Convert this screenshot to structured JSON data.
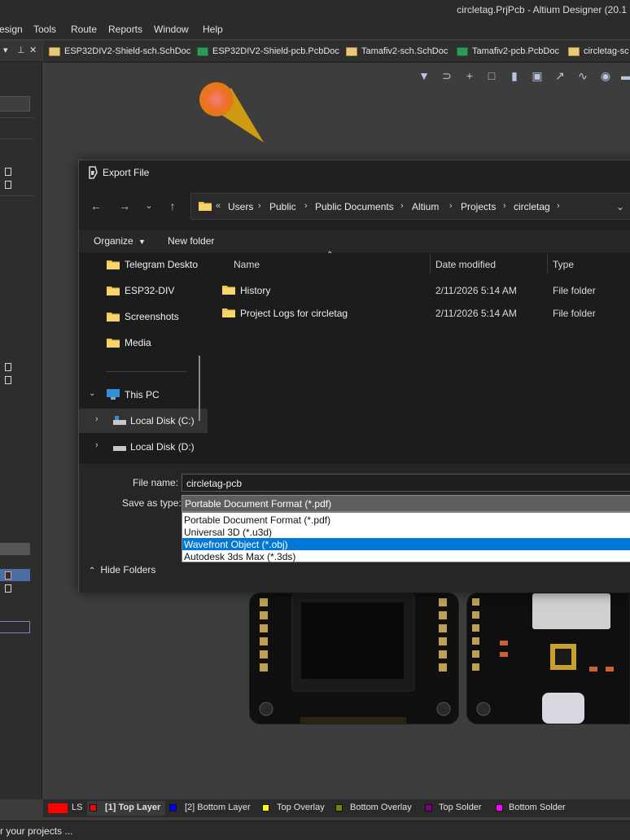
{
  "app": {
    "title": "circletag.PrjPcb - Altium Designer (20.1"
  },
  "menu": [
    "esign",
    "Tools",
    "Route",
    "Reports",
    "Window",
    "Help"
  ],
  "panel_header": {
    "pin": "▾",
    "lock": "⊥",
    "close": "✕"
  },
  "doc_tabs": [
    {
      "label": "ESP32DIV2-Shield-sch.SchDoc",
      "kind": "sch"
    },
    {
      "label": "ESP32DIV2-Shield-pcb.PcbDoc",
      "kind": "pcb"
    },
    {
      "label": "Tamafiv2-sch.SchDoc",
      "kind": "sch"
    },
    {
      "label": "Tamafiv2-pcb.PcbDoc",
      "kind": "pcb"
    },
    {
      "label": "circletag-sc",
      "kind": "sch"
    }
  ],
  "dialog": {
    "title": "Export File",
    "address": {
      "prefix": "«",
      "crumbs": [
        "Users",
        "Public",
        "Public Documents",
        "Altium",
        "Projects",
        "circletag"
      ]
    },
    "commands": {
      "organize": "Organize",
      "new_folder": "New folder"
    },
    "nav_items": [
      {
        "label": "Telegram Deskto",
        "icon": "folder-icon"
      },
      {
        "label": "ESP32-DIV",
        "icon": "folder-icon"
      },
      {
        "label": "Screenshots",
        "icon": "folder-icon"
      },
      {
        "label": "Media",
        "icon": "folder-icon"
      },
      {
        "label": "This PC",
        "icon": "pc-icon"
      },
      {
        "label": "Local Disk (C:)",
        "icon": "disk-icon"
      },
      {
        "label": "Local Disk (D:)",
        "icon": "disk-icon"
      }
    ],
    "columns": {
      "name": "Name",
      "date": "Date modified",
      "type": "Type"
    },
    "files": [
      {
        "name": "History",
        "date": "2/11/2026 5:14 AM",
        "type": "File folder"
      },
      {
        "name": "Project Logs for circletag",
        "date": "2/11/2026 5:14 AM",
        "type": "File folder"
      }
    ],
    "file_name_label": "File name:",
    "file_name_value": "circletag-pcb",
    "save_type_label": "Save as type:",
    "save_type_value": "Portable Document Format (*.pdf)",
    "save_type_options": [
      {
        "label": "Portable Document Format (*.pdf)",
        "selected": false
      },
      {
        "label": "Universal 3D (*.u3d)",
        "selected": false
      },
      {
        "label": "Wavefront Object (*.obj)",
        "selected": true
      },
      {
        "label": "Autodesk 3ds Max (*.3ds)",
        "selected": false
      }
    ],
    "hide_folders": "Hide Folders"
  },
  "layer_tabs": [
    {
      "label": "LS",
      "color": "#ff0000"
    },
    {
      "label": "[1] Top Layer",
      "color": "#ff0000",
      "active": true
    },
    {
      "label": "[2] Bottom Layer",
      "color": "#0000ff"
    },
    {
      "label": "Top Overlay",
      "color": "#ffff00"
    },
    {
      "label": "Bottom Overlay",
      "color": "#808000"
    },
    {
      "label": "Top Solder",
      "color": "#800080"
    },
    {
      "label": "Bottom Solder",
      "color": "#ff00ff"
    }
  ],
  "status": "r your projects ...",
  "colors": {
    "selection": "#0078d7",
    "accent_layer": "#ff0000"
  }
}
